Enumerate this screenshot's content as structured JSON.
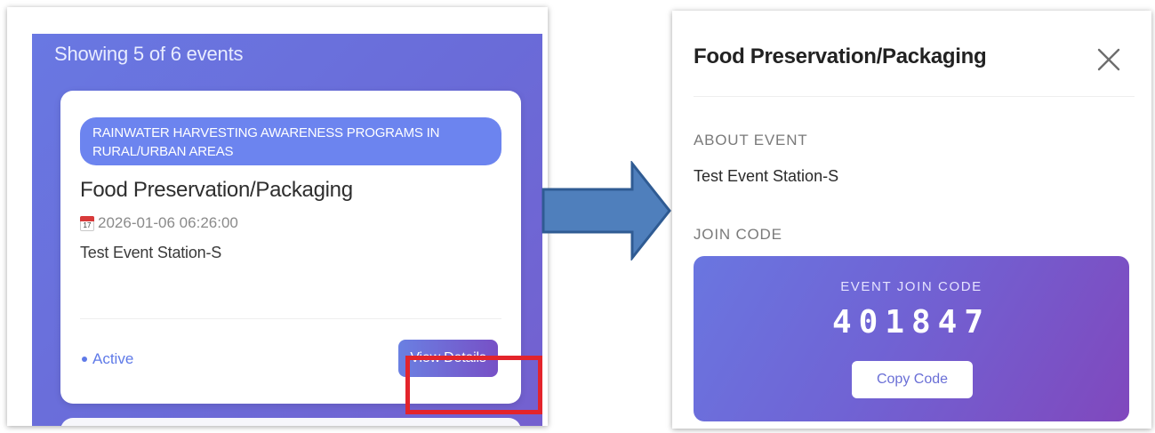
{
  "left_panel": {
    "events_count": "Showing 5 of 6 events",
    "event_card": {
      "category": "RAINWATER HARVESTING AWARENESS PROGRAMS IN RURAL/URBAN AREAS",
      "title": "Food Preservation/Packaging",
      "calendar_day": "17",
      "datetime": "2026-01-06 06:26:00",
      "location": "Test Event Station-S",
      "status": "Active",
      "view_details_label": "View Details"
    }
  },
  "right_panel": {
    "modal_title": "Food Preservation/Packaging",
    "about_label": "ABOUT EVENT",
    "about_value": "Test Event Station-S",
    "join_code_label": "JOIN CODE",
    "join_card": {
      "label": "EVENT JOIN CODE",
      "code": "401847",
      "copy_label": "Copy Code"
    }
  },
  "icons": {
    "calendar": "calendar-icon",
    "close": "close-icon",
    "arrow": "right-arrow-icon"
  },
  "colors": {
    "accent_gradient_start": "#6a78e2",
    "accent_gradient_end": "#7a4fc3",
    "highlight": "#e3242b",
    "arrow_fill": "#4f7fbc",
    "status_active": "#5f7ae8"
  }
}
